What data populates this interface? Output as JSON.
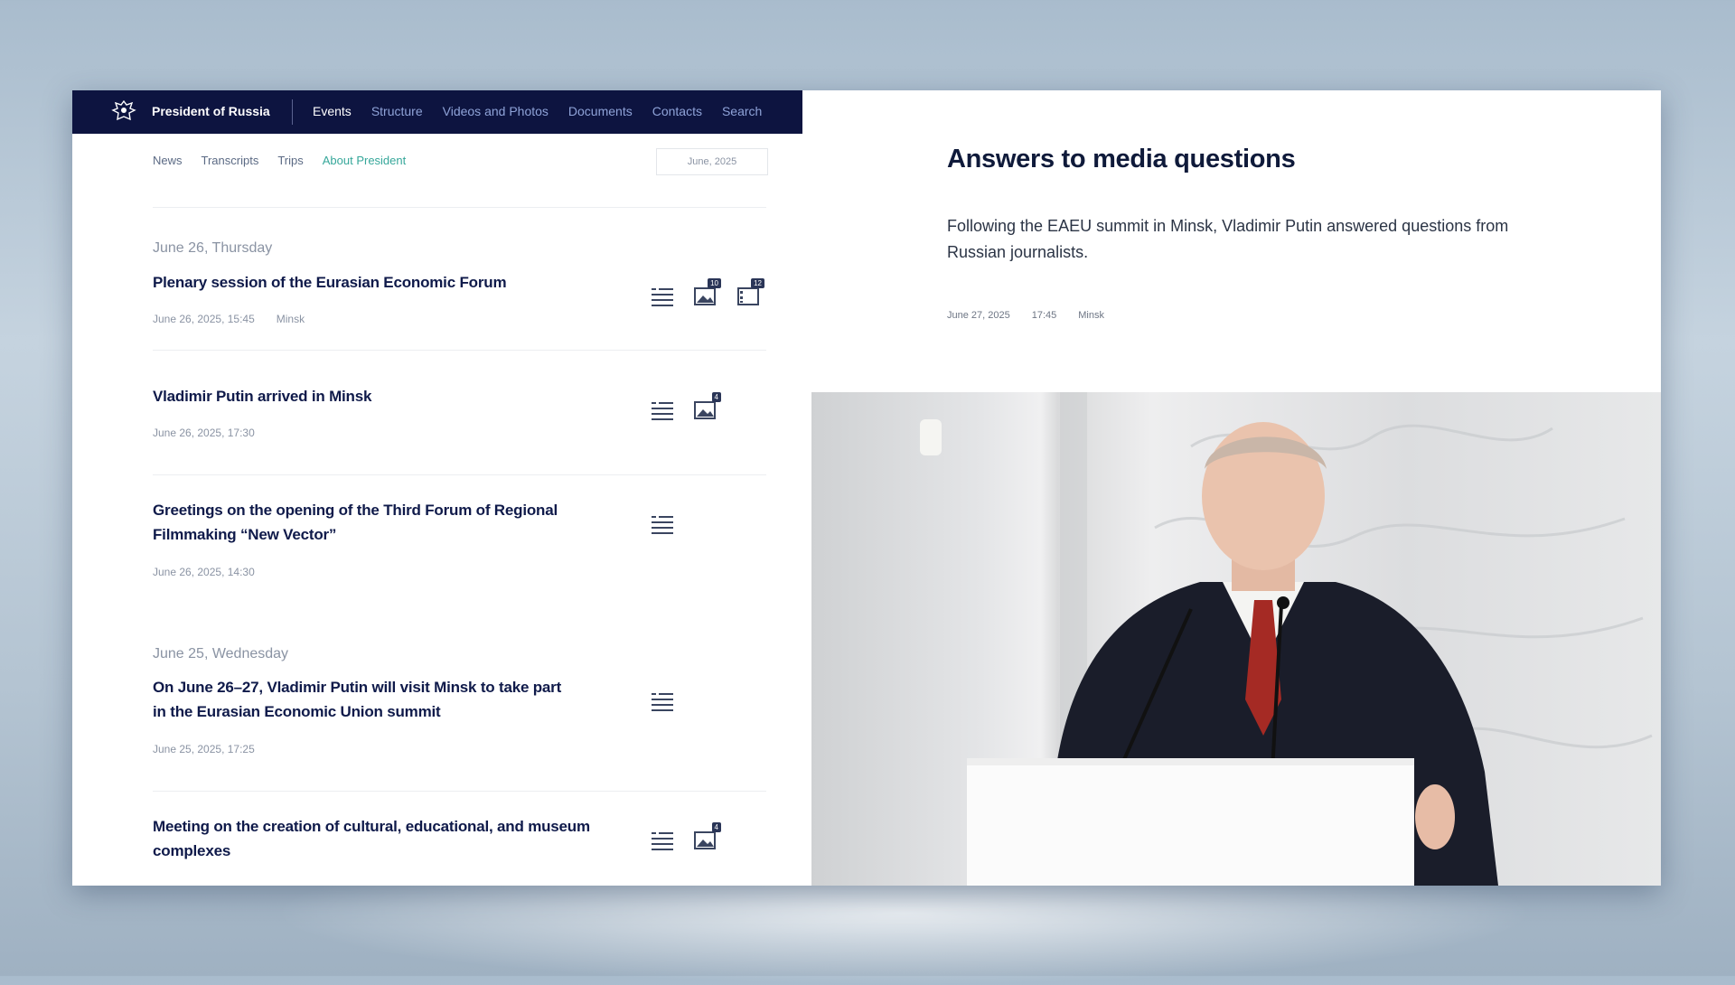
{
  "topbar": {
    "brand": "President of Russia",
    "nav": [
      "Events",
      "Structure",
      "Videos and Photos",
      "Documents",
      "Contacts",
      "Search"
    ]
  },
  "subnav": {
    "items": [
      "News",
      "Transcripts",
      "Trips",
      "About President"
    ],
    "date_filter": "June, 2025"
  },
  "feed": {
    "day1": "June 26, Thursday",
    "day2": "June 25, Wednesday",
    "items": [
      {
        "title": "Plenary session of the Eurasian Economic Forum",
        "time": "June 26, 2025, 15:45",
        "place": "Minsk",
        "photo_count": "10",
        "video_count": "12"
      },
      {
        "title": "Vladimir Putin arrived in Minsk",
        "time": "June 26, 2025, 17:30",
        "photo_count": "4"
      },
      {
        "title": "Greetings on the opening of the Third Forum of Regional Filmmaking “New Vector”",
        "time": "June 26, 2025, 14:30"
      },
      {
        "title": "On June 26–27, Vladimir Putin will visit Minsk to take part in the Eurasian Economic Union summit",
        "time": "June 25, 2025, 17:25"
      },
      {
        "title": "Meeting on the creation of cultural, educational, and museum complexes",
        "photo_count": "4"
      }
    ]
  },
  "article": {
    "title": "Answers to media questions",
    "lead": "Following the EAEU summit in Minsk, Vladimir Putin answered questions from Russian journalists.",
    "date": "June 27, 2025",
    "time": "17:45",
    "place": "Minsk"
  },
  "icons": {
    "emblem": "russian-eagle-emblem",
    "transcript": "text-lines-icon",
    "photo": "photo-gallery-icon",
    "video": "video-film-icon"
  }
}
